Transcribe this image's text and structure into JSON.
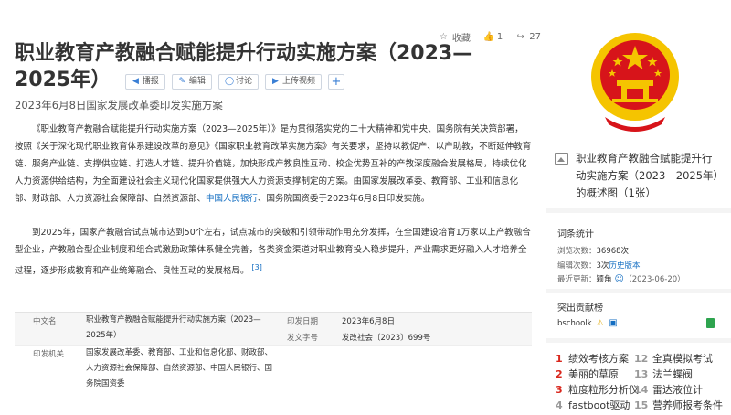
{
  "top_actions": {
    "favorite": "收藏",
    "like_count": "1",
    "share_count": "27"
  },
  "title": "职业教育产教融合赋能提升行动实施方案（2023—2025年）",
  "title_buttons": {
    "play": "播报",
    "edit": "编辑",
    "discuss": "讨论",
    "upload_video": "上传视频"
  },
  "subtitle": "2023年6月8日国家发展改革委印发实施方案",
  "paragraph1": {
    "before_link": "《职业教育产教融合赋能提升行动实施方案（2023—2025年）》是为贯彻落实党的二十大精神和党中央、国务院有关决策部署，按照《关于深化现代职业教育体系建设改革的意见》《国家职业教育改革实施方案》有关要求，坚持以教促产、以产助教，不断延伸教育链、服务产业链、支撑供应链、打造人才链、提升价值链，加快形成产教良性互动、校企优势互补的产教深度融合发展格局，持续优化人力资源供给结构，为全面建设社会主义现代化国家提供强大人力资源支撑制定的方案。由国家发展改革委、教育部、工业和信息化部、财政部、人力资源社会保障部、自然资源部、",
    "link": "中国人民银行",
    "after_link": "、国务院国资委于2023年6月8日印发实施。"
  },
  "paragraph2": {
    "text": "到2025年，国家产教融合试点城市达到50个左右，试点城市的突破和引领带动作用充分发挥，在全国建设培育1万家以上产教融合型企业，产教融合型企业制度和组合式激励政策体系健全完善，各类资金渠道对职业教育投入稳步提升，产业需求更好融入人才培养全过程，逐步形成教育和产业统筹融合、良性互动的发展格局。",
    "ref": "[3]"
  },
  "info_table": {
    "rows": [
      {
        "label": "中文名",
        "value": "职业教育产教融合赋能提升行动实施方案（2023—2025年）",
        "label2": "印发日期",
        "value2": "2023年6月8日"
      },
      {
        "label2": "发文字号",
        "value2": "发改社会〔2023〕699号"
      },
      {
        "label": "印发机关",
        "value": "国家发展改革委、教育部、工业和信息化部、财政部、人力资源社会保障部、自然资源部、中国人民银行、国务院国资委"
      }
    ]
  },
  "album_caption": {
    "text": "职业教育产教融合赋能提升行动实施方案（2023—2025年）的概述图（1张）"
  },
  "stats": {
    "title": "词条统计",
    "views_label": "浏览次数：",
    "views_value": "36968次",
    "edits_label": "编辑次数：",
    "edits_value": "3次",
    "history_link": "历史版本",
    "updated_label": "最近更新：",
    "updated_user": "颖角",
    "updated_date": "（2023-06-20）"
  },
  "contributors": {
    "title": "突出贡献榜",
    "user": "bschoolk"
  },
  "hot_list": [
    {
      "num": "1",
      "text": "绩效考核方案"
    },
    {
      "num": "12",
      "text": "全真模拟考试"
    },
    {
      "num": "2",
      "text": "美丽的草原"
    },
    {
      "num": "13",
      "text": "法兰蝶阀"
    },
    {
      "num": "3",
      "text": "粒度粒形分析仪"
    },
    {
      "num": "14",
      "text": "雷达液位计"
    },
    {
      "num": "4",
      "text": "fastboot驱动"
    },
    {
      "num": "15",
      "text": "营养师报考条件"
    }
  ],
  "colors": {
    "link": "#136ec2",
    "hot_number": "#d9261c",
    "emblem_red": "#d7141a",
    "emblem_gold": "#f5c400"
  }
}
